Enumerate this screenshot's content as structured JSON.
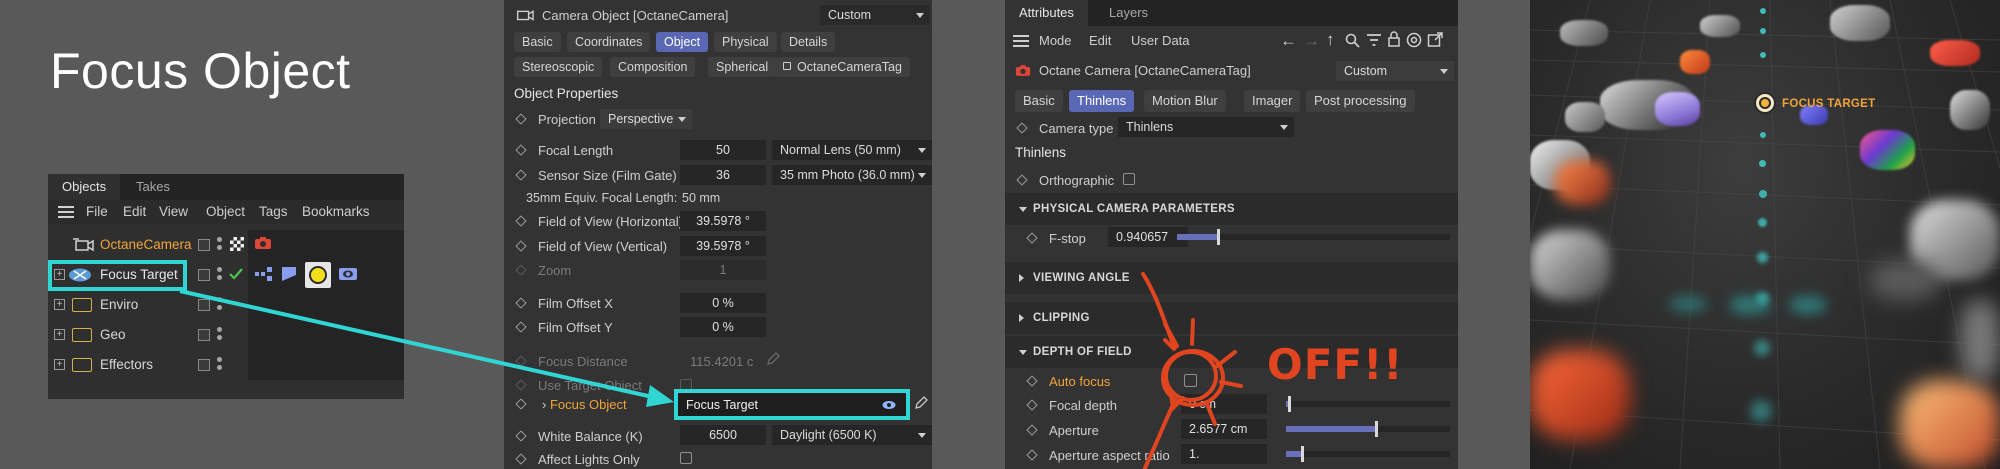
{
  "title": "Focus Object",
  "objects_panel": {
    "tabs": [
      "Objects",
      "Takes"
    ],
    "menu": [
      "File",
      "Edit",
      "View",
      "Object",
      "Tags",
      "Bookmarks"
    ],
    "rows": [
      {
        "label": "OctaneCamera"
      },
      {
        "label": "Focus Target"
      },
      {
        "label": "Enviro"
      },
      {
        "label": "Geo"
      },
      {
        "label": "Effectors"
      }
    ]
  },
  "properties_panel": {
    "header": {
      "title": "Camera Object [OctaneCamera]",
      "mode": "Custom"
    },
    "tabs_row1": [
      "Basic",
      "Coordinates",
      "Object",
      "Physical",
      "Details"
    ],
    "tabs_row2": [
      "Stereoscopic",
      "Composition",
      "Spherical",
      "OctaneCameraTag"
    ],
    "section": "Object Properties",
    "projection": {
      "label": "Projection",
      "value": "Perspective"
    },
    "focal_length": {
      "label": "Focal Length",
      "value": "50",
      "preset": "Normal Lens (50 mm)"
    },
    "sensor_size": {
      "label": "Sensor Size (Film Gate)",
      "value": "36",
      "preset": "35 mm Photo (36.0 mm)"
    },
    "equiv": {
      "label": "35mm Equiv. Focal Length:",
      "value": "50 mm"
    },
    "fov_h": {
      "label": "Field of View (Horizontal)",
      "value": "39.5978 °"
    },
    "fov_v": {
      "label": "Field of View (Vertical)",
      "value": "39.5978 °"
    },
    "zoom": {
      "label": "Zoom",
      "value": "1"
    },
    "film_offset_x": {
      "label": "Film Offset X",
      "value": "0 %"
    },
    "film_offset_y": {
      "label": "Film Offset Y",
      "value": "0 %"
    },
    "focus_distance": {
      "label": "Focus Distance",
      "value": "115.4201 c"
    },
    "use_target": {
      "label": "Use Target Object"
    },
    "focus_object": {
      "label": "Focus Object",
      "value": "Focus Target"
    },
    "white_balance": {
      "label": "White Balance (K)",
      "value": "6500",
      "preset": "Daylight (6500 K)"
    },
    "affect_lights": {
      "label": "Affect Lights Only"
    }
  },
  "attributes_panel": {
    "tabs": [
      "Attributes",
      "Layers"
    ],
    "menu": [
      "Mode",
      "Edit",
      "User Data"
    ],
    "header": {
      "title": "Octane Camera [OctaneCameraTag]",
      "mode": "Custom"
    },
    "subtabs": [
      "Basic",
      "Thinlens",
      "Motion Blur",
      "Imager",
      "Post processing"
    ],
    "camera_type": {
      "label": "Camera type",
      "value": "Thinlens"
    },
    "heading": "Thinlens",
    "orthographic": {
      "label": "Orthographic"
    },
    "sections": {
      "physical": "PHYSICAL CAMERA PARAMETERS",
      "viewing": "VIEWING ANGLE",
      "clipping": "CLIPPING",
      "dof": "DEPTH OF FIELD"
    },
    "fstop": {
      "label": "F-stop",
      "value": "0.940657",
      "level": 0.15
    },
    "auto_focus": {
      "label": "Auto focus"
    },
    "focal_depth": {
      "label": "Focal depth",
      "value": "0 cm",
      "level": 0.02
    },
    "aperture": {
      "label": "Aperture",
      "value": "2.6577 cm",
      "level": 0.55
    },
    "aperture_ratio": {
      "label": "Aperture aspect ratio",
      "value": "1.",
      "level": 0.1
    },
    "annotation": "OFF!!"
  },
  "viewport": {
    "label": "FOCUS TARGET"
  },
  "colors": {
    "accent_cyan": "#2fd6d3",
    "annotation_red": "#e0451f",
    "active_tab": "#5a67b5",
    "orange_label": "#f0a43a"
  }
}
